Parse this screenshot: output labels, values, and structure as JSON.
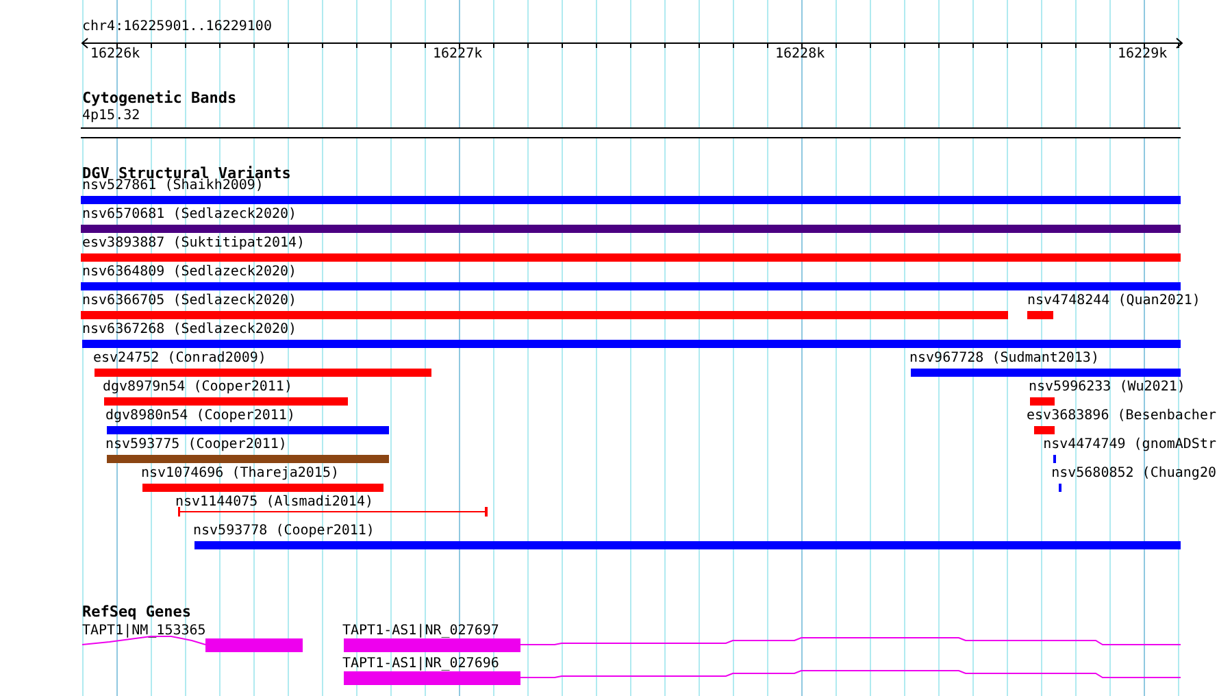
{
  "ruler": {
    "location": "chr4:16225901..16229100",
    "ticks": [
      "16226k",
      "16227k",
      "16228k",
      "16229k"
    ]
  },
  "tracks": [
    {
      "kind": "bands",
      "title": "Cytogenetic Bands",
      "bands": [
        "4p15.32"
      ]
    },
    {
      "kind": "variants",
      "title": "DGV Structural Variants",
      "features": [
        {
          "label": "nsv527861 (Shaikh2009)",
          "kind": "bar",
          "color": "#0000ff"
        },
        {
          "label": "nsv6570681 (Sedlazeck2020)",
          "kind": "bar",
          "color": "#4b0082"
        },
        {
          "label": "esv3893887 (Suktitipat2014)",
          "kind": "bar",
          "color": "#ff0000"
        },
        {
          "label": "nsv6364809 (Sedlazeck2020)",
          "kind": "bar",
          "color": "#0000ff"
        },
        {
          "label": "nsv6366705 (Sedlazeck2020)",
          "kind": "bar",
          "color": "#ff0000"
        },
        {
          "label": "nsv4748244 (Quan2021)",
          "kind": "bar",
          "color": "#ff0000"
        },
        {
          "label": "nsv6367268 (Sedlazeck2020)",
          "kind": "bar",
          "color": "#0000ff"
        },
        {
          "label": "esv24752 (Conrad2009)",
          "kind": "bar",
          "color": "#ff0000"
        },
        {
          "label": "nsv967728 (Sudmant2013)",
          "kind": "bar",
          "color": "#0000ff"
        },
        {
          "label": "dgv8979n54 (Cooper2011)",
          "kind": "bar",
          "color": "#ff0000"
        },
        {
          "label": "nsv5996233 (Wu2021)",
          "kind": "bar",
          "color": "#ff0000"
        },
        {
          "label": "dgv8980n54 (Cooper2011)",
          "kind": "bar",
          "color": "#0000ff"
        },
        {
          "label": "esv3683896 (Besenbacher",
          "kind": "bar",
          "color": "#ff0000"
        },
        {
          "label": "nsv593775 (Cooper2011)",
          "kind": "bar",
          "color": "#8b4513"
        },
        {
          "label": "nsv4474749 (gnomADStr",
          "kind": "bar",
          "color": "#0000ff"
        },
        {
          "label": "nsv1074696 (Thareja2015)",
          "kind": "bar",
          "color": "#ff0000"
        },
        {
          "label": "nsv5680852 (Chuang20",
          "kind": "bar",
          "color": "#0000ff"
        },
        {
          "label": "nsv1144075 (Alsmadi2014)",
          "kind": "interval",
          "color": "#ff0000"
        },
        {
          "label": "nsv593778 (Cooper2011)",
          "kind": "bar",
          "color": "#0000ff"
        }
      ]
    },
    {
      "kind": "genes",
      "title": "RefSeq Genes",
      "genes": [
        {
          "label": "TAPT1|NM_153365"
        },
        {
          "label": "TAPT1-AS1|NR_027697"
        },
        {
          "label": "TAPT1-AS1|NR_027696"
        }
      ]
    }
  ]
}
